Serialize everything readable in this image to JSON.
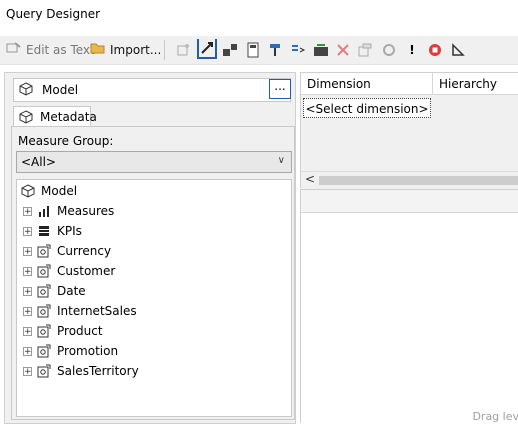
{
  "window": {
    "title": "Query Designer"
  },
  "toolbar": {
    "edit_as_text": "Edit as Text",
    "import": "Import...",
    "cube_item_button": "!"
  },
  "model": {
    "cube_name": "Model",
    "ellipsis": "...",
    "tab": "Metadata",
    "measure_group_label": "Measure Group:",
    "measure_group_value": "<All>"
  },
  "tree": {
    "root": "Model",
    "items": [
      {
        "label": "Measures",
        "icon": "measures-icon"
      },
      {
        "label": "KPIs",
        "icon": "kpi-icon"
      },
      {
        "label": "Currency",
        "icon": "dimension-icon"
      },
      {
        "label": "Customer",
        "icon": "dimension-icon"
      },
      {
        "label": "Date",
        "icon": "dimension-icon"
      },
      {
        "label": "InternetSales",
        "icon": "dimension-icon"
      },
      {
        "label": "Product",
        "icon": "dimension-icon"
      },
      {
        "label": "Promotion",
        "icon": "dimension-icon"
      },
      {
        "label": "SalesTerritory",
        "icon": "dimension-icon"
      }
    ]
  },
  "filter_grid": {
    "columns": [
      "Dimension",
      "Hierarchy"
    ],
    "placeholder_row": "<Select dimension>"
  },
  "data_pane": {
    "hint": "Drag lev"
  },
  "colors": {
    "highlight": "#1c5fb0",
    "red_stop": "#e03a3a"
  }
}
